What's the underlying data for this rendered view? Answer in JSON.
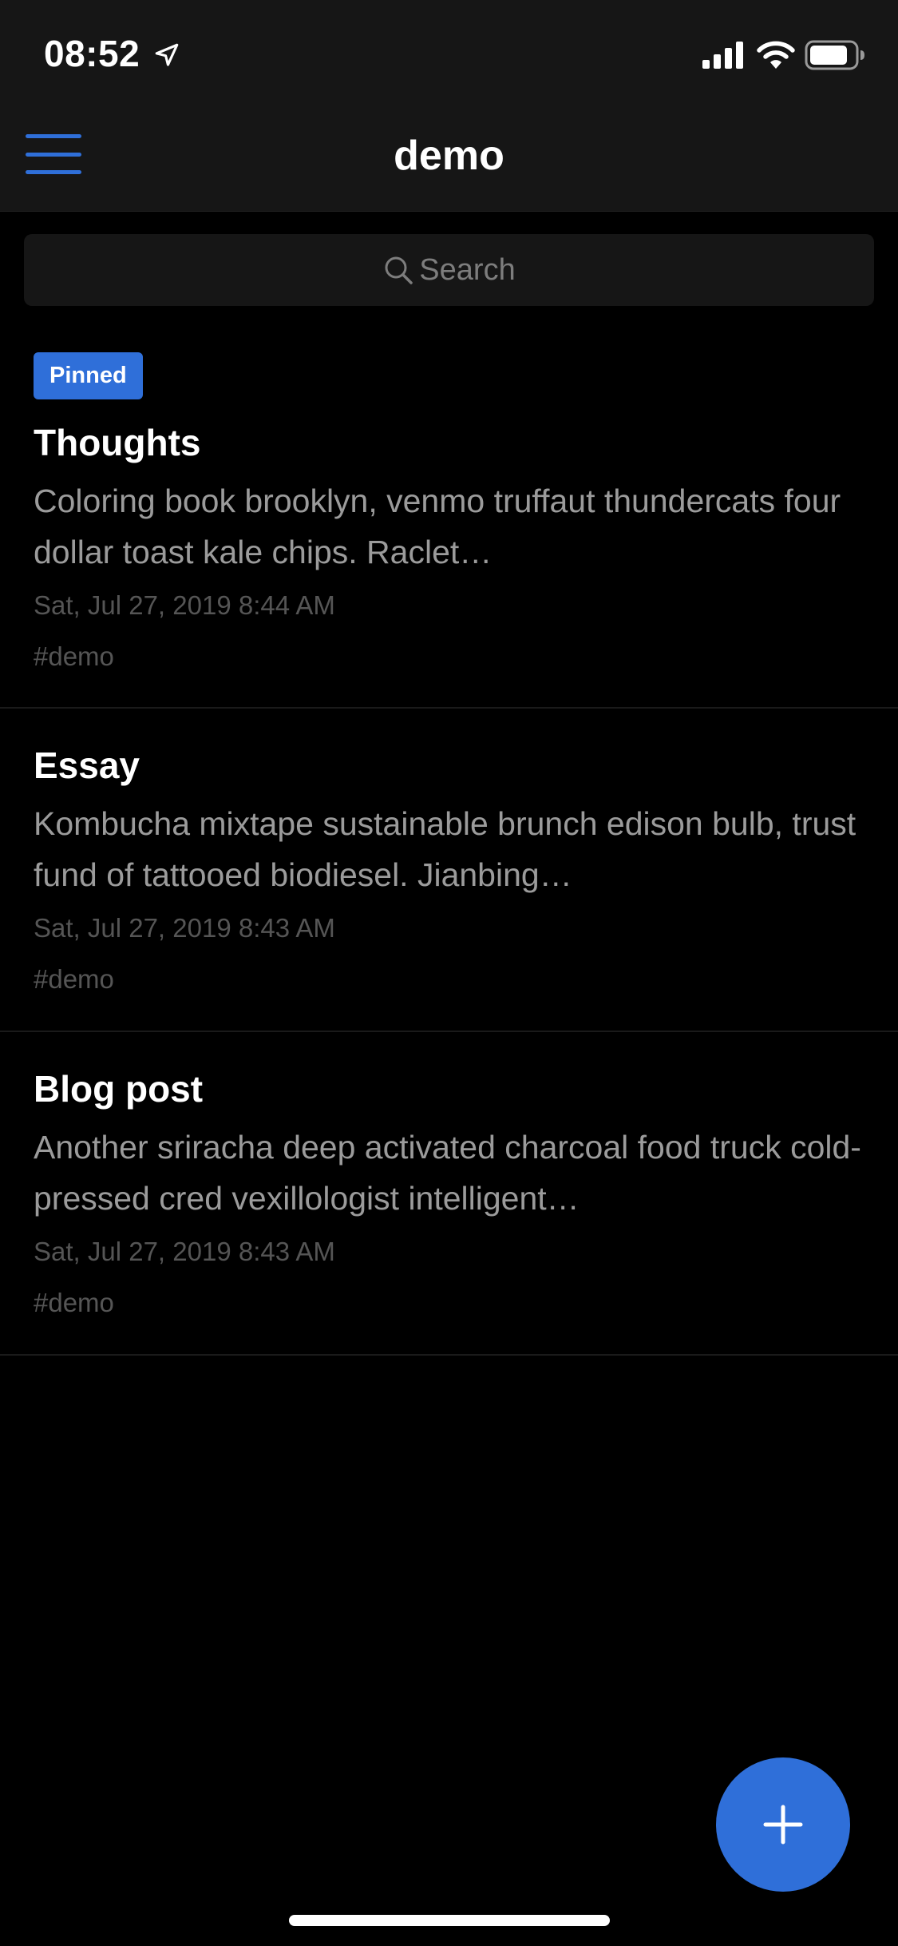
{
  "status_bar": {
    "time": "08:52",
    "icons": [
      "location-arrow-icon",
      "cellular-signal-icon",
      "wifi-icon",
      "battery-icon"
    ]
  },
  "header": {
    "title": "demo",
    "menu_icon": "hamburger-menu-icon"
  },
  "search": {
    "placeholder": "Search",
    "icon": "search-icon"
  },
  "notes": [
    {
      "pinned": true,
      "pinned_label": "Pinned",
      "title": "Thoughts",
      "preview": "Coloring book brooklyn, venmo truffaut thundercats four dollar toast kale chips. Raclet…",
      "date": "Sat, Jul 27, 2019 8:44 AM",
      "tag": "#demo"
    },
    {
      "pinned": false,
      "title": "Essay",
      "preview": "Kombucha mixtape sustainable brunch edison bulb, trust fund of tattooed biodiesel. Jianbing…",
      "date": "Sat, Jul 27, 2019 8:43 AM",
      "tag": "#demo"
    },
    {
      "pinned": false,
      "title": "Blog post",
      "preview": "Another sriracha deep activated charcoal food truck cold-pressed cred vexillologist intelligent…",
      "date": "Sat, Jul 27, 2019 8:43 AM",
      "tag": "#demo"
    }
  ],
  "fab": {
    "icon": "plus-icon"
  },
  "colors": {
    "accent": "#2f6fd9",
    "background": "#000000",
    "header_background": "#161616",
    "preview_text": "#9b9b9b",
    "meta_text": "#555555"
  }
}
